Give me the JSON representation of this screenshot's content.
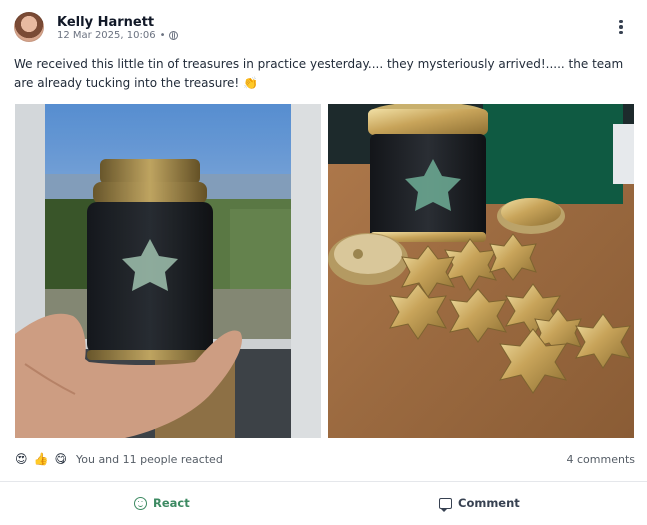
{
  "post": {
    "author": "Kelly Harnett",
    "date": "12 Mar 2025, 10:06",
    "separator": "•",
    "text": "We received this little tin of treasures in practice yesterday.... they mysteriously arrived!..... the team are already tucking into the treasure! 👏",
    "visibility_icon": "globe-icon",
    "menu_icon": "kebab-menu-icon"
  },
  "photos": [
    {
      "description_icon": "photo-tin-in-hand"
    },
    {
      "description_icon": "photo-tin-with-chocolates"
    }
  ],
  "reactions": {
    "emojis": [
      "😍",
      "👍",
      "😋"
    ],
    "summary": "You and 11 people reacted",
    "comments": "4 comments"
  },
  "actions": {
    "react_label": "React",
    "comment_label": "Comment"
  },
  "colors": {
    "accent_green": "#3d8a62",
    "text": "#1f2937",
    "muted": "#555d66"
  }
}
